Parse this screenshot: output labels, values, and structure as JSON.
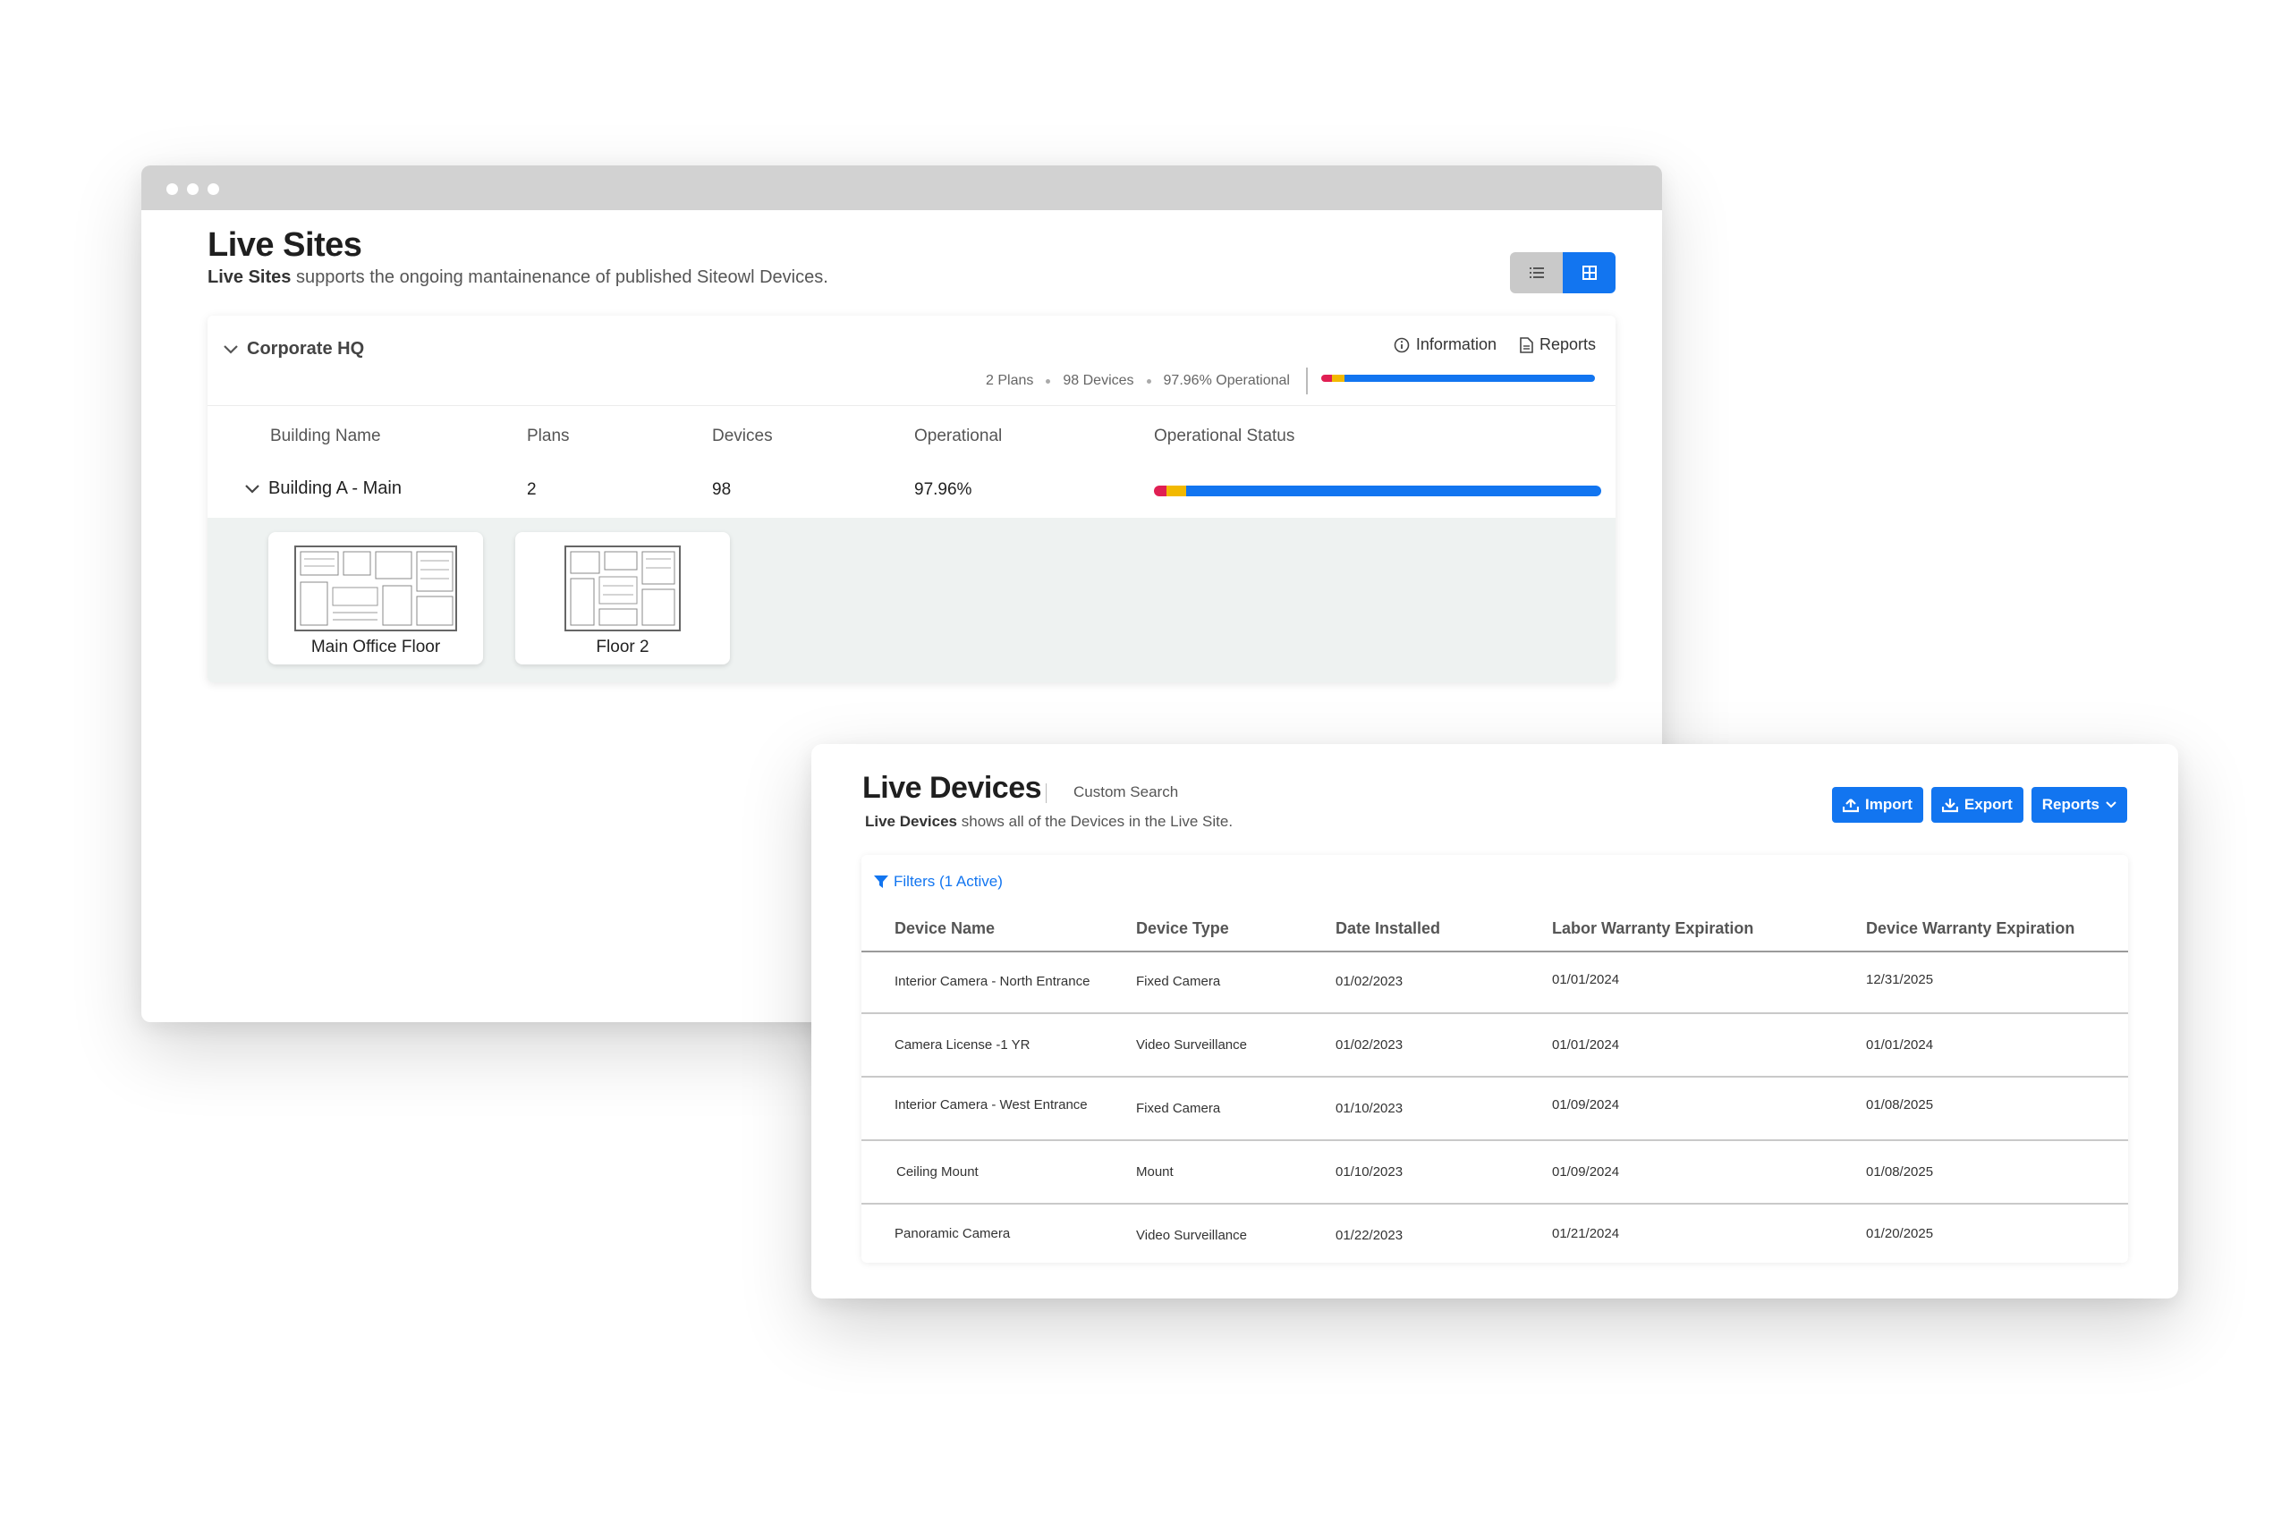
{
  "live_sites": {
    "title": "Live Sites",
    "subtitle_bold": "Live Sites",
    "subtitle_rest": " supports the ongoing mantainenance of published Siteowl Devices.",
    "site": {
      "name": "Corporate HQ",
      "information_label": "Information",
      "reports_label": "Reports",
      "plans_stat": "2 Plans",
      "devices_stat": "98 Devices",
      "operational_stat": "97.96% Operational"
    },
    "table_headers": [
      "Building Name",
      "Plans",
      "Devices",
      "Operational",
      "Operational Status"
    ],
    "building": {
      "name": "Building A - Main",
      "plans": "2",
      "devices": "98",
      "operational": "97.96%"
    },
    "plans": [
      {
        "label": "Main Office Floor"
      },
      {
        "label": "Floor 2"
      }
    ]
  },
  "live_devices": {
    "title": "Live Devices",
    "custom_search": "Custom Search",
    "subtitle_bold": "Live Devices",
    "subtitle_rest": " shows all of the Devices in the Live Site.",
    "buttons": {
      "import": "Import",
      "export": "Export",
      "reports": "Reports"
    },
    "filters_label": "Filters (1 Active)",
    "columns": [
      "Device Name",
      "Device Type",
      "Date Installed",
      "Labor Warranty Expiration",
      "Device Warranty Expiration"
    ],
    "rows": [
      [
        "Interior Camera - North Entrance",
        "Fixed Camera",
        "01/02/2023",
        "01/01/2024",
        "12/31/2025"
      ],
      [
        "Camera License -1 YR",
        "Video Surveillance",
        "01/02/2023",
        "01/01/2024",
        "01/01/2024"
      ],
      [
        "Interior Camera - West Entrance",
        "Fixed Camera",
        "01/10/2023",
        "01/09/2024",
        "01/08/2025"
      ],
      [
        "Ceiling Mount",
        "Mount",
        "01/10/2023",
        "01/09/2024",
        "01/08/2025"
      ],
      [
        "Panoramic Camera",
        "Video Surveillance",
        "01/22/2023",
        "01/21/2024",
        "01/20/2025"
      ]
    ]
  },
  "colors": {
    "accent_blue": "#1275f0",
    "status_red": "#e01f53",
    "status_yellow": "#f2b900"
  },
  "icons": [
    "chevron-down-icon",
    "info-icon",
    "document-icon",
    "list-view-icon",
    "grid-view-icon",
    "filter-icon",
    "upload-icon",
    "download-icon"
  ]
}
